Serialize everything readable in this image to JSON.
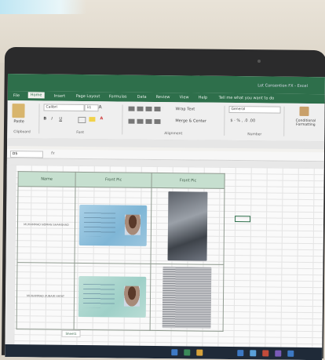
{
  "window": {
    "title": "Lot Consention FX - Excel"
  },
  "ribbon": {
    "tabs": [
      "File",
      "Home",
      "Insert",
      "Page Layout",
      "Formulas",
      "Data",
      "Review",
      "View",
      "Help"
    ],
    "active_tab": "Home",
    "tell_me": "Tell me what you want to do",
    "font_name": "Calibri",
    "font_size": "11",
    "paste_label": "Paste",
    "wrap_text": "Wrap Text",
    "merge_center": "Merge & Center",
    "number_format": "General",
    "conditional_formatting": "Conditional Formatting",
    "groups": {
      "clipboard": "Clipboard",
      "font": "Font",
      "alignment": "Alignment",
      "number": "Number"
    }
  },
  "formula_bar": {
    "name_box": "D5",
    "fx": "fx"
  },
  "table": {
    "headers": [
      "Name",
      "Front Pic",
      "Front Pic"
    ],
    "rows": [
      {
        "name": "MUHAMMAD NOMAN SHAMSHAD"
      },
      {
        "name": "MUHAMMAD ZUBAIR HAYAT"
      }
    ]
  },
  "sheet_tab": "Sheet1",
  "colors": {
    "excel_green": "#2e6f4b",
    "header_fill": "#c6dfcf"
  }
}
